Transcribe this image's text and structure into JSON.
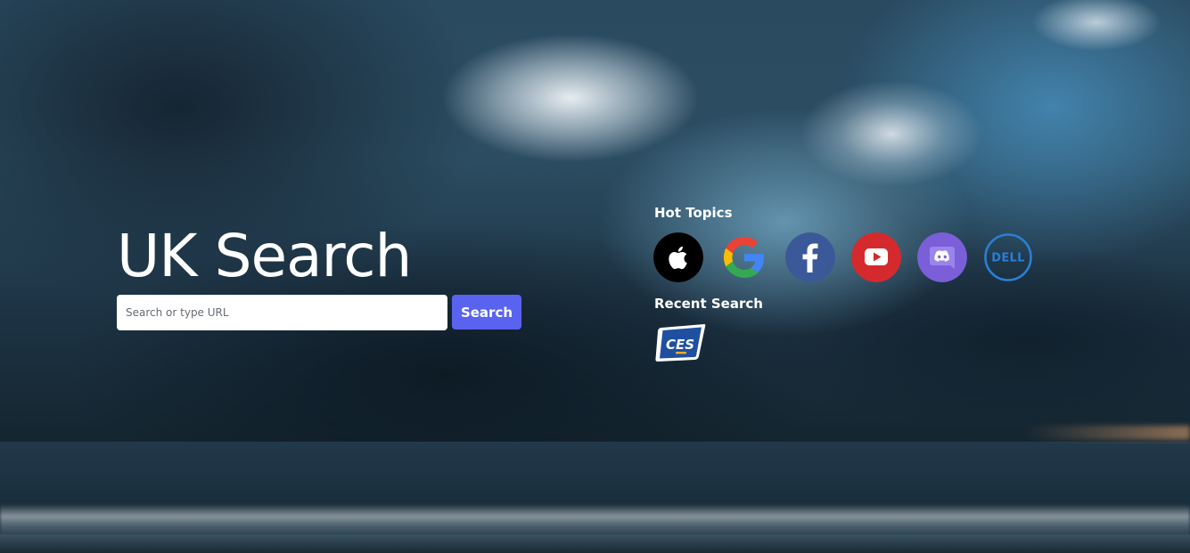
{
  "app": {
    "brand": "UK Search"
  },
  "search": {
    "placeholder": "Search or type URL",
    "value": "",
    "button_label": "Search",
    "button_color": "#5a63f0"
  },
  "hot_topics": {
    "heading": "Hot Topics",
    "items": [
      {
        "name": "Apple",
        "icon": "apple-icon",
        "color": "#000000"
      },
      {
        "name": "Google",
        "icon": "google-icon",
        "color": "#4285f4"
      },
      {
        "name": "Facebook",
        "icon": "facebook-icon",
        "color": "#3b5998"
      },
      {
        "name": "YouTube",
        "icon": "youtube-icon",
        "color": "#e52d27"
      },
      {
        "name": "Discord",
        "icon": "discord-icon",
        "color": "#7e63e3"
      },
      {
        "name": "Dell",
        "icon": "dell-icon",
        "color": "#2a7fd4",
        "logo_text": "DELL"
      }
    ]
  },
  "recent_search": {
    "heading": "Recent Search",
    "items": [
      {
        "name": "CES",
        "icon": "ces-icon",
        "color": "#1f4fa0",
        "logo_text": "CES"
      }
    ]
  }
}
